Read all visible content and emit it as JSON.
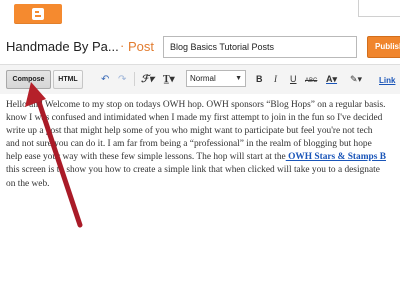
{
  "header": {
    "blog_title": "Handmade By Pa...",
    "separator": "·",
    "post_label": "Post",
    "title_value": "Blog Basics Tutorial Posts",
    "publish_label": "Publish"
  },
  "toolbar": {
    "compose_label": "Compose",
    "html_label": "HTML",
    "font_value": "Normal",
    "link_label": "Link",
    "icons": [
      "undo-icon",
      "redo-icon",
      "font-family-icon",
      "font-size-icon",
      "bold-icon",
      "italic-icon",
      "underline-icon",
      "strikethrough-icon",
      "text-color-icon",
      "highlight-icon"
    ]
  },
  "editor": {
    "lines": [
      "Hello and Welcome to my stop on todays OWH hop. OWH sponsors “Blog Hops” on a regular basis.",
      "know I was confused and intimidated when I made my first attempt to join in the fun so I've decided",
      "write up a post that might help some of you who might want to participate but feel you're not tech",
      "and not sure you can do it. I am far from being a “professional” in the realm of blogging but hope",
      "help ease your way with these few simple lessons. The hop will start at the",
      "this screen is to show you how to create a simple link that when clicked will take you to a designate",
      "on the web."
    ],
    "link_text": " OWH Stars & Stamps B"
  },
  "colors": {
    "brand_orange": "#f58a2f",
    "post_orange": "#e27c2f",
    "link_blue": "#1a55b8",
    "arrow_red": "#b5202a"
  }
}
